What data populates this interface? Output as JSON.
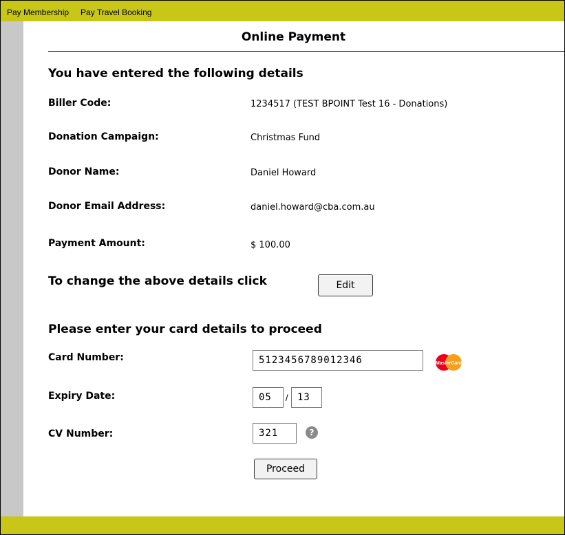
{
  "nav": {
    "items": [
      {
        "label": "Pay Membership"
      },
      {
        "label": "Pay Travel Booking"
      }
    ]
  },
  "page": {
    "title": "Online Payment"
  },
  "details": {
    "heading": "You have entered the following details",
    "fields": [
      {
        "label": "Biller Code:",
        "value": "1234517 (TEST BPOINT Test 16 - Donations)"
      },
      {
        "label": "Donation Campaign:",
        "value": "Christmas Fund"
      },
      {
        "label": "Donor Name:",
        "value": "Daniel Howard"
      },
      {
        "label": "Donor Email Address:",
        "value": "daniel.howard@cba.com.au"
      },
      {
        "label": "Payment Amount:",
        "value": "$ 100.00"
      }
    ],
    "change_text": "To change the above details click",
    "edit_label": "Edit"
  },
  "card": {
    "heading": "Please enter your card details to proceed",
    "number_label": "Card Number:",
    "number_value": "5123456789012346",
    "card_brand_text": "MasterCard",
    "expiry_label": "Expiry Date:",
    "expiry_month": "05",
    "expiry_separator": "/",
    "expiry_year": "13",
    "cv_label": "CV Number:",
    "cv_value": "321",
    "help_glyph": "?",
    "proceed_label": "Proceed"
  },
  "colors": {
    "bar": "#c8c617",
    "side": "#c8c8c8",
    "mastercard_red": "#eb001b",
    "mastercard_orange": "#f79e1b"
  }
}
